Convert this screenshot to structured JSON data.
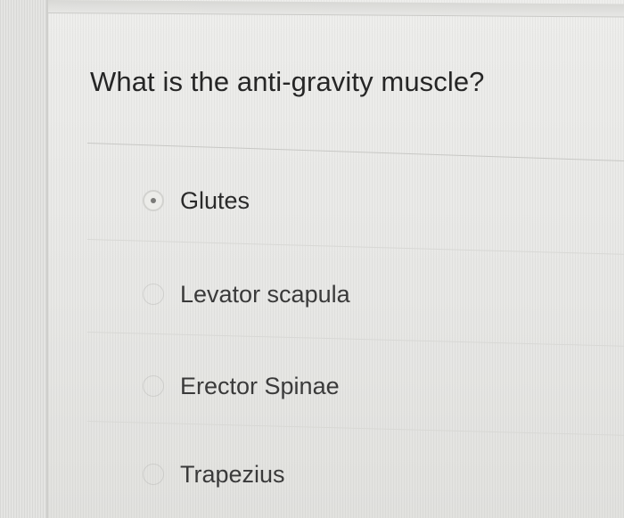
{
  "question": {
    "text": "What is the anti-gravity muscle?"
  },
  "options": [
    {
      "label": "Glutes",
      "selected": true
    },
    {
      "label": "Levator scapula",
      "selected": false
    },
    {
      "label": "Erector Spinae",
      "selected": false
    },
    {
      "label": "Trapezius",
      "selected": false
    }
  ],
  "colors": {
    "background": "#e9e9e7",
    "text": "#262626",
    "divider": "#cfcfcc",
    "radio_dot": "#7a7a78"
  },
  "icons": {
    "radio": "radio-button-icon"
  }
}
